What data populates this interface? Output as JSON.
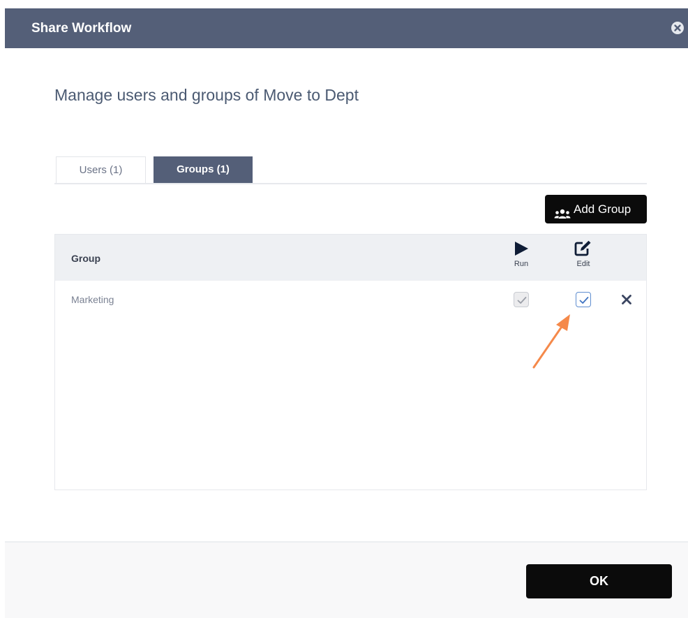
{
  "dialog": {
    "title": "Share Workflow",
    "subtitle": "Manage users and groups of Move to Dept"
  },
  "tabs": [
    {
      "label": "Users (1)",
      "active": false
    },
    {
      "label": "Groups (1)",
      "active": true
    }
  ],
  "toolbar": {
    "add_group_label": "Add Group",
    "add_group_icon": "users-icon"
  },
  "table": {
    "columns": {
      "group": "Group",
      "run": "Run",
      "run_icon": "play-icon",
      "edit": "Edit",
      "edit_icon": "edit-icon"
    },
    "rows": [
      {
        "name": "Marketing",
        "run": true,
        "run_disabled": true,
        "edit": true
      }
    ]
  },
  "footer": {
    "ok_label": "OK"
  },
  "colors": {
    "header_bg": "#545f78",
    "button_bg": "#0b0b0b",
    "annotation_arrow": "#f5894a",
    "checkbox_accent": "#5f8ed0"
  }
}
